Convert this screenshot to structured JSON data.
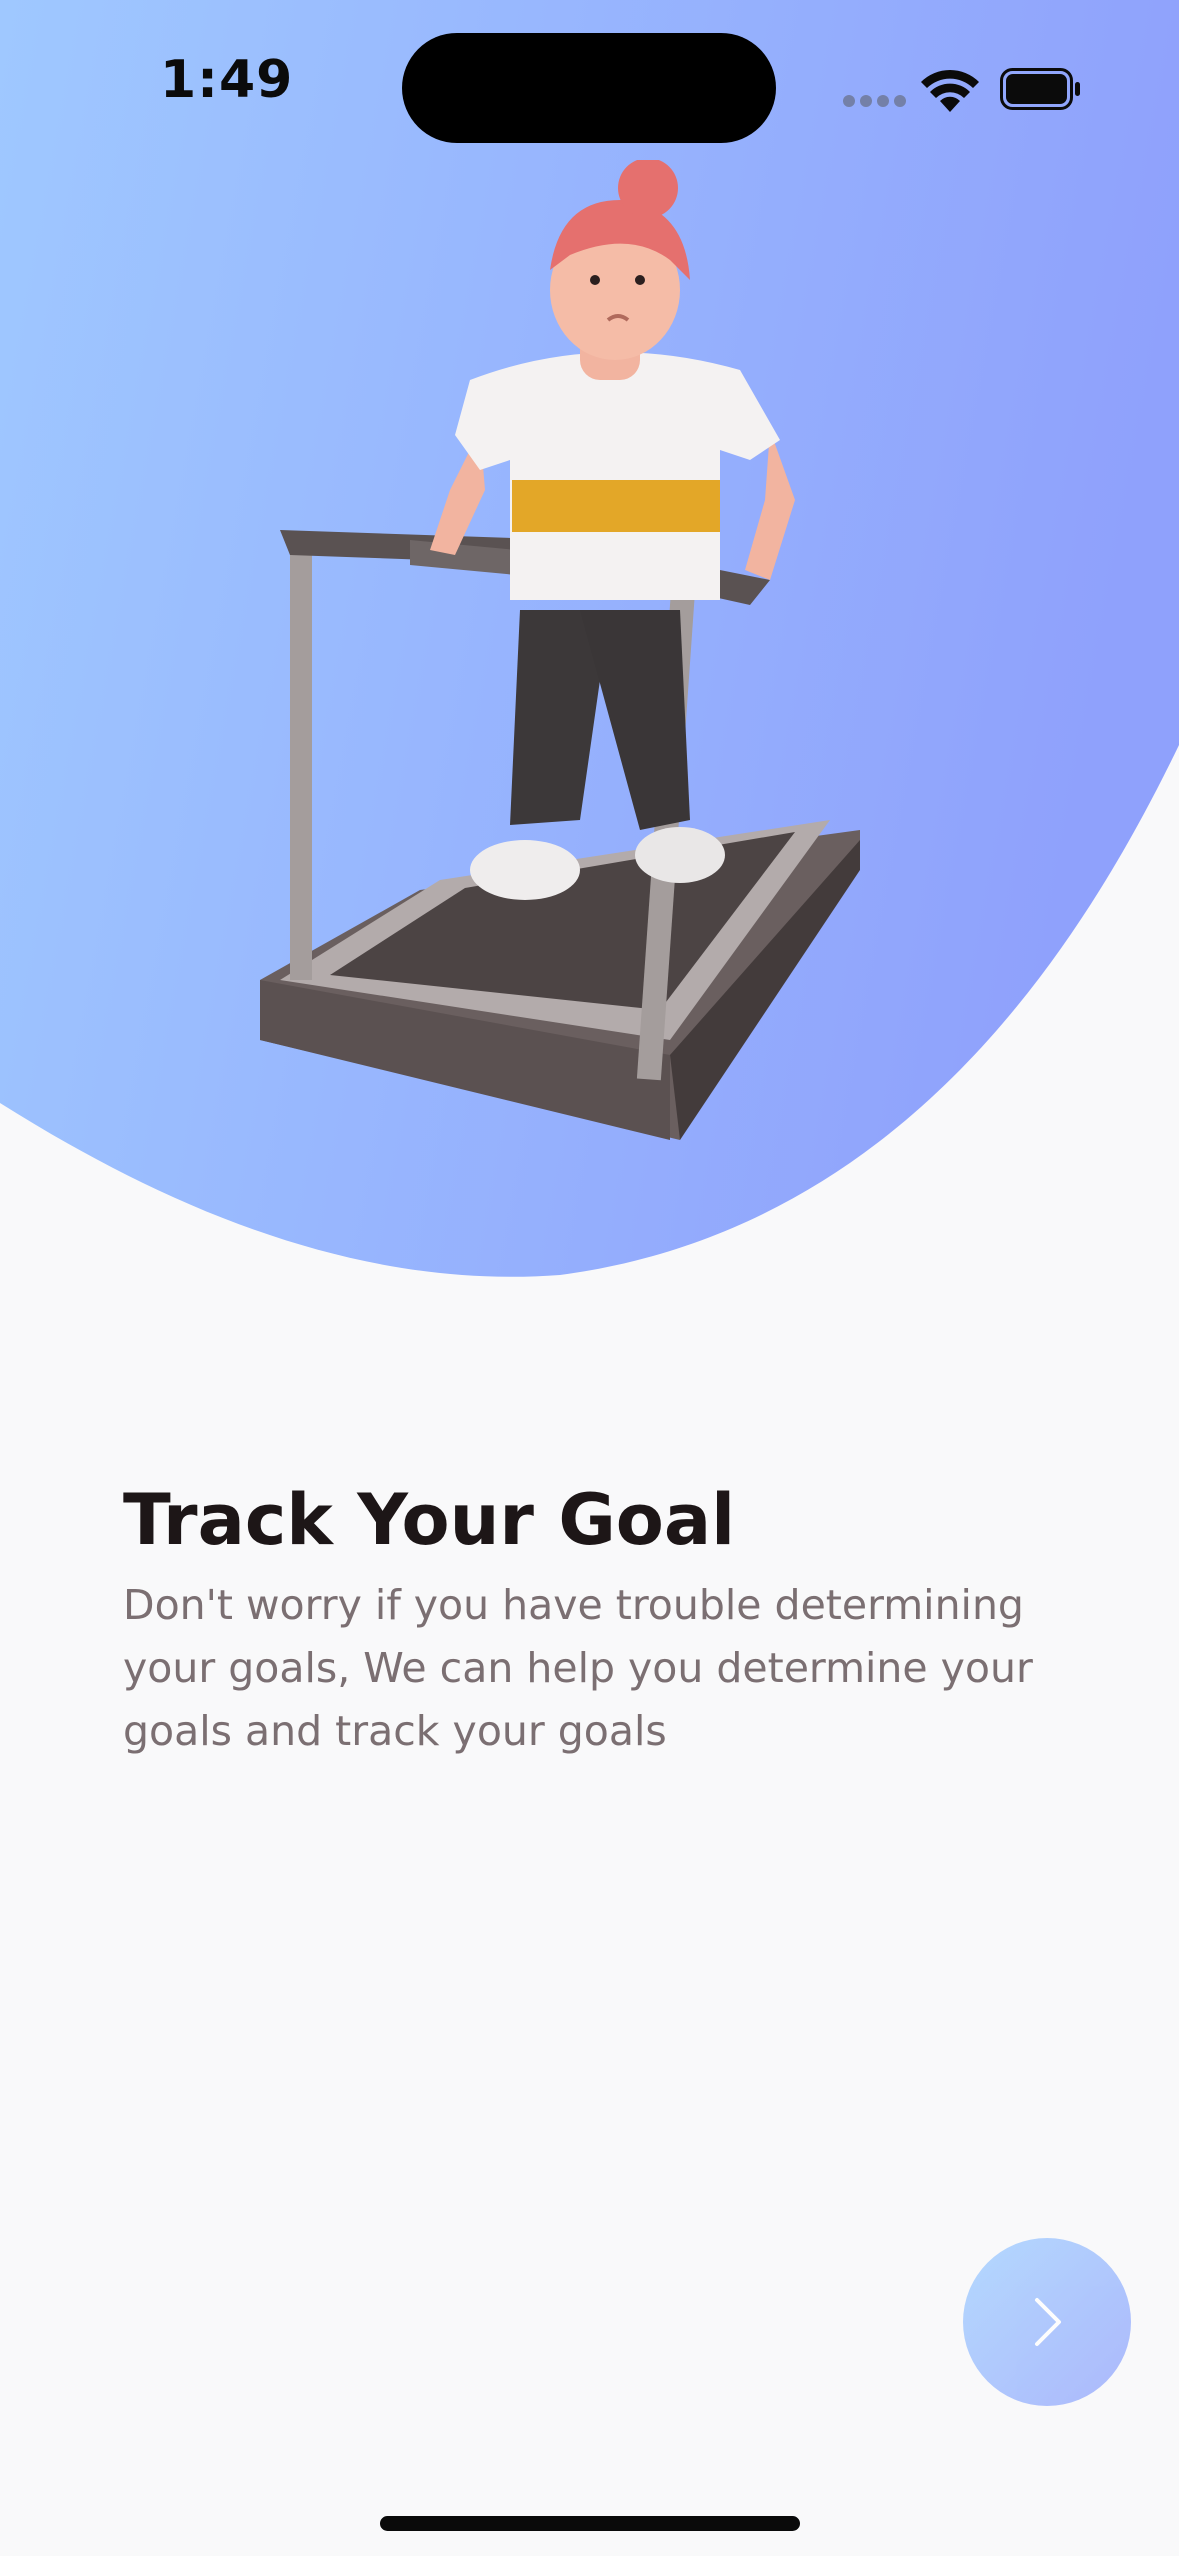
{
  "status_bar": {
    "time": "1:49"
  },
  "onboarding": {
    "title": "Track Your Goal",
    "description": "Don't worry if you have trouble determining your goals, We can help you determine your goals and track your goals"
  },
  "next_button": {
    "icon": "chevron-right-icon"
  },
  "colors": {
    "hero_gradient_start": "#9dceff",
    "hero_gradient_end": "#92a3fd",
    "background": "#f9f9fa",
    "title": "#1d1617",
    "body_text": "#7b6f72"
  },
  "illustration": {
    "subject": "woman-on-treadmill"
  }
}
